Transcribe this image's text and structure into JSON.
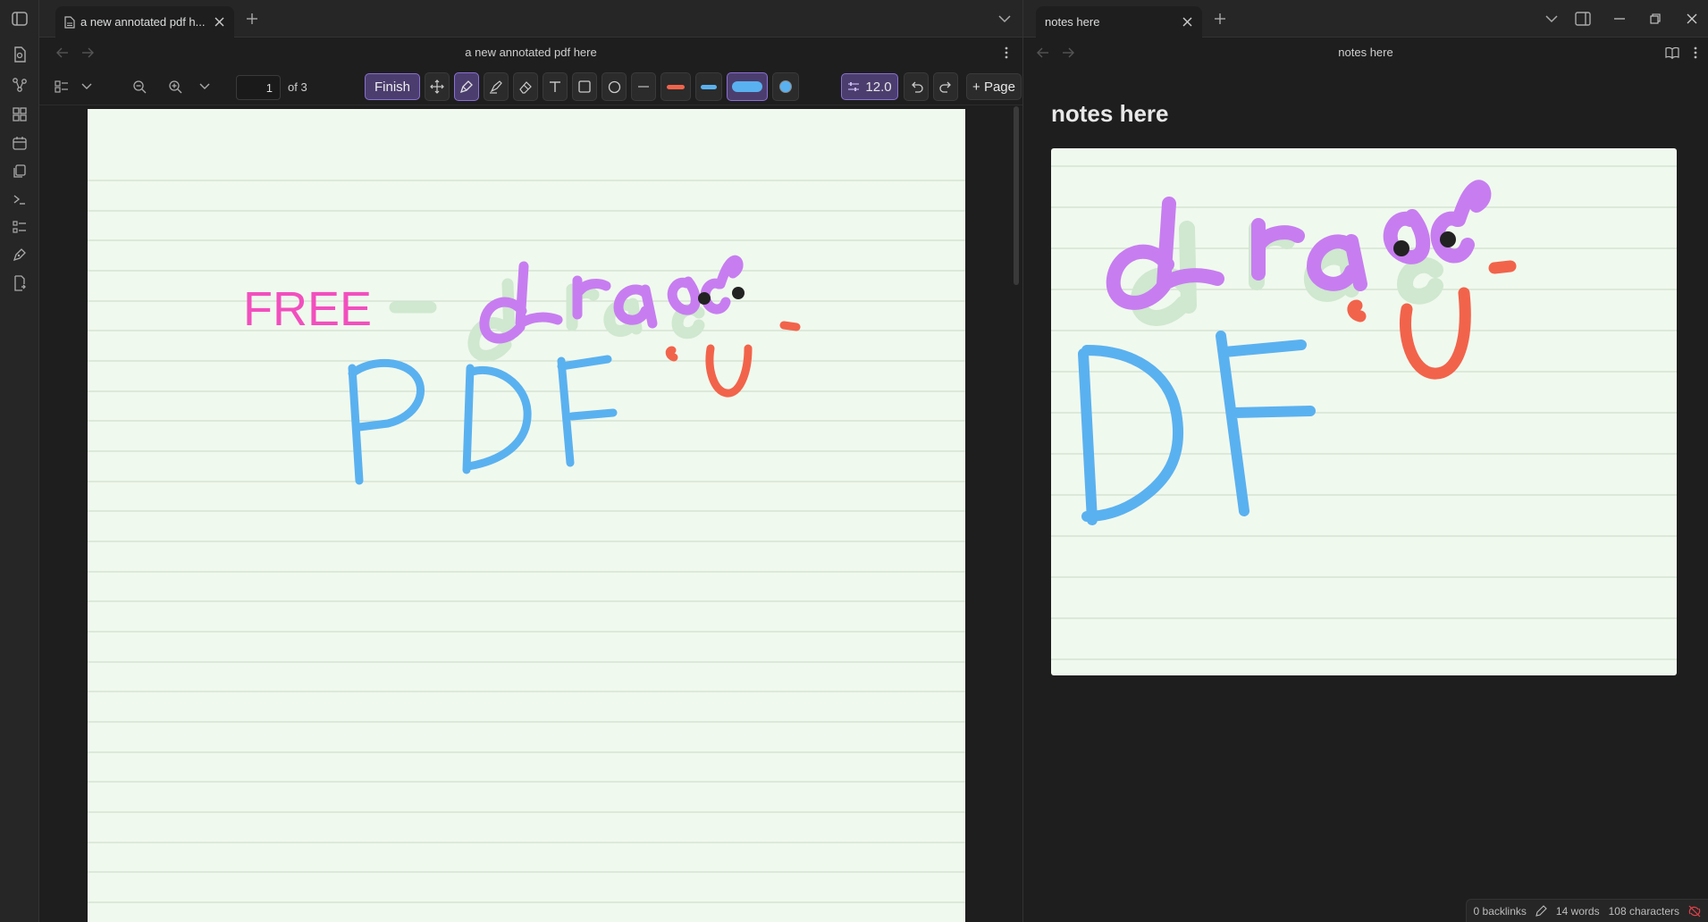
{
  "left": {
    "tab_title": "a new annotated pdf h...",
    "nav_title": "a new annotated pdf here",
    "page_number": "1",
    "page_of": "of 3",
    "finish_label": "Finish",
    "stroke_width": "12.0",
    "add_page_label": "+ Page",
    "pdf_text": {
      "free": "FREE",
      "dash": "–"
    }
  },
  "right": {
    "tab_title": "notes here",
    "nav_title": "notes here",
    "note_title": "notes here"
  },
  "status": {
    "backlinks": "0 backlinks",
    "words": "14 words",
    "characters": "108 characters"
  },
  "colors": {
    "accent": "#8a6fd1",
    "pen_purple": "#c77df0",
    "pen_blue": "#5ab1f0",
    "pen_red": "#f2634b",
    "pen_pink": "#f24fbe",
    "ghost_green": "#cfe8cf",
    "paper": "#f0f9ee",
    "rule_line": "#cfe0cf"
  }
}
